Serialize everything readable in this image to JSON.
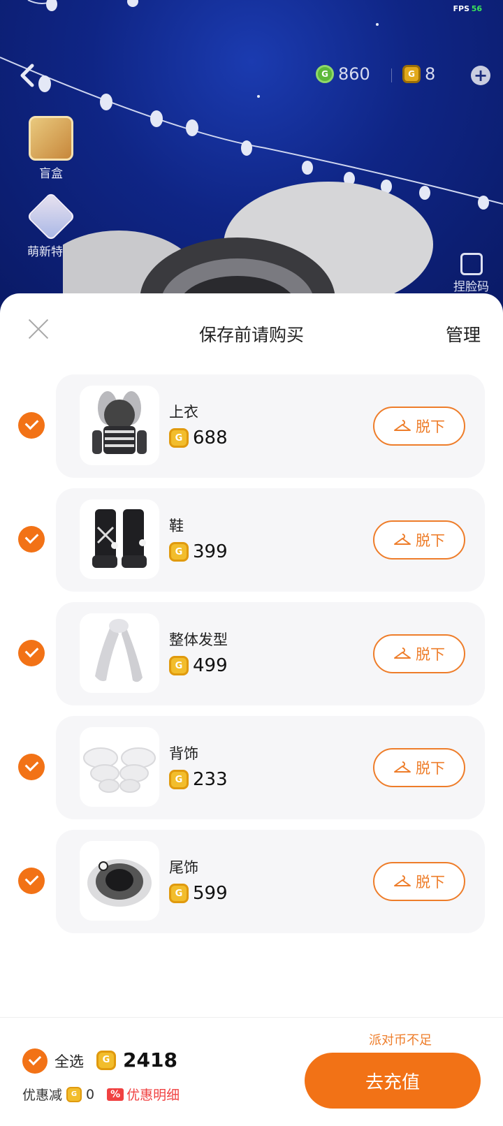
{
  "status": {
    "fps_label": "FPS",
    "fps_value": "56"
  },
  "topbar": {
    "green_currency": "860",
    "gold_currency": "8"
  },
  "side_entries": {
    "mystery_box": "盲盒",
    "newbie_deal": "萌新特惠",
    "face_code": "捏脸码"
  },
  "sheet": {
    "title": "保存前请购买",
    "manage": "管理"
  },
  "items": [
    {
      "name": "上衣",
      "price": "688",
      "action": "脱下",
      "checked": true,
      "icon": "top-clothing-thumbnail"
    },
    {
      "name": "鞋",
      "price": "399",
      "action": "脱下",
      "checked": true,
      "icon": "boots-thumbnail"
    },
    {
      "name": "整体发型",
      "price": "499",
      "action": "脱下",
      "checked": true,
      "icon": "hairstyle-thumbnail"
    },
    {
      "name": "背饰",
      "price": "233",
      "action": "脱下",
      "checked": true,
      "icon": "wings-thumbnail"
    },
    {
      "name": "尾饰",
      "price": "599",
      "action": "脱下",
      "checked": true,
      "icon": "tail-thumbnail"
    }
  ],
  "footer": {
    "select_all": "全选",
    "total": "2418",
    "discount_label": "优惠减",
    "discount_value": "0",
    "discount_tag": "%",
    "discount_detail": "优惠明细",
    "insufficient": "派对币不足",
    "recharge": "去充值"
  },
  "colors": {
    "accent": "#f27216",
    "coin_gold": "#f2bd2c",
    "discount_red": "#f04141",
    "fps_green": "#3ce65a"
  }
}
